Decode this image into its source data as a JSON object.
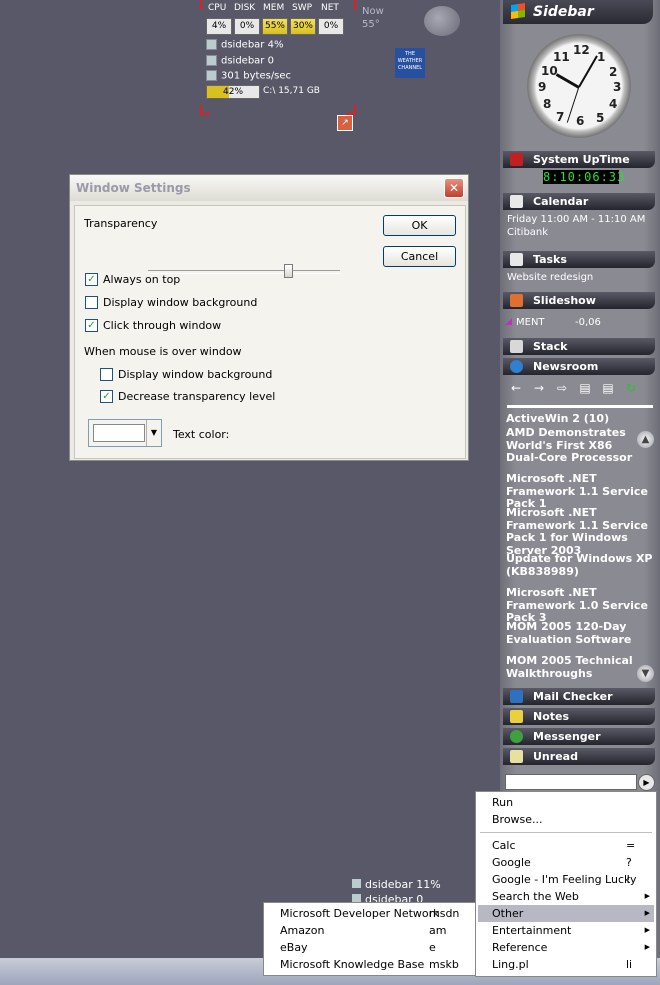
{
  "monitor": {
    "headers": [
      "CPU",
      "DISK",
      "MEM",
      "SWP",
      "NET"
    ],
    "values": [
      "4%",
      "0%",
      "55%",
      "30%",
      "0%"
    ],
    "rows": [
      "dsidebar 4%",
      "dsidebar 0",
      "301 bytes/sec"
    ],
    "disk_bar_label": "42%",
    "disk_bar_fraction": 0.42,
    "disk_info": "C:\\ 15,71 GB"
  },
  "weather": {
    "now_label": "Now",
    "temp": "55°",
    "logo_text": "THE WEATHER CHANNEL"
  },
  "dialog": {
    "title": "Window Settings",
    "transparency_label": "Transparency",
    "transparency_level": 0.74,
    "ok": "OK",
    "cancel": "Cancel",
    "always_on_top": "Always on top",
    "display_bg": "Display window background",
    "click_through": "Click through window",
    "mouse_over_label": "When mouse is over window",
    "mo_display_bg": "Display window background",
    "mo_decrease": "Decrease transparency level",
    "text_color": "Text color:"
  },
  "sidebar": {
    "title": "Sidebar",
    "panels": {
      "uptime": "System UpTime",
      "calendar": "Calendar",
      "tasks": "Tasks",
      "slideshow": "Slideshow",
      "stack": "Stack",
      "newsroom": "Newsroom",
      "mail": "Mail Checker",
      "notes": "Notes",
      "messenger": "Messenger",
      "unread": "Unread"
    },
    "uptime_value": "8:10:06:33",
    "calendar_event": "Friday 11:00 AM - 11:10 AM",
    "calendar_place": "Citibank",
    "task_item": "Website redesign",
    "ticker_symbol": "MENT",
    "ticker_change": "-0,06",
    "news": [
      "ActiveWin 2 (10)",
      "AMD Demonstrates World's First X86 Dual-Core Processor",
      "Microsoft .NET Framework 1.1 Service Pack 1",
      "Microsoft .NET Framework 1.1 Service Pack 1 for Windows Server 2003",
      "Update for Windows XP (KB838989)",
      "Microsoft .NET Framework 1.0 Service Pack 3",
      "MOM 2005 120-Day Evaluation Software",
      "MOM 2005 Technical Walkthroughs"
    ]
  },
  "run_menu": {
    "items": [
      {
        "label": "Run",
        "key": "",
        "sub": false
      },
      {
        "label": "Browse...",
        "key": "",
        "sub": false
      },
      {
        "label": "Calc",
        "key": "=",
        "sub": false
      },
      {
        "label": "Google",
        "key": "?",
        "sub": false
      },
      {
        "label": "Google - I'm Feeling Lucky",
        "key": "!",
        "sub": false
      },
      {
        "label": "Search the Web",
        "key": "",
        "sub": true
      },
      {
        "label": "Other",
        "key": "",
        "sub": true
      },
      {
        "label": "Entertainment",
        "key": "",
        "sub": true
      },
      {
        "label": "Reference",
        "key": "",
        "sub": true
      },
      {
        "label": "Ling.pl",
        "key": "li",
        "sub": false
      }
    ]
  },
  "sub_menu": {
    "items": [
      {
        "label": "Microsoft Developer Network",
        "key": "msdn"
      },
      {
        "label": "Amazon",
        "key": "am"
      },
      {
        "label": "eBay",
        "key": "e"
      },
      {
        "label": "Microsoft Knowledge Base",
        "key": "mskb"
      }
    ]
  },
  "ghost_monitor": {
    "row1": "dsidebar 11%",
    "row2": "dsidebar 0"
  }
}
